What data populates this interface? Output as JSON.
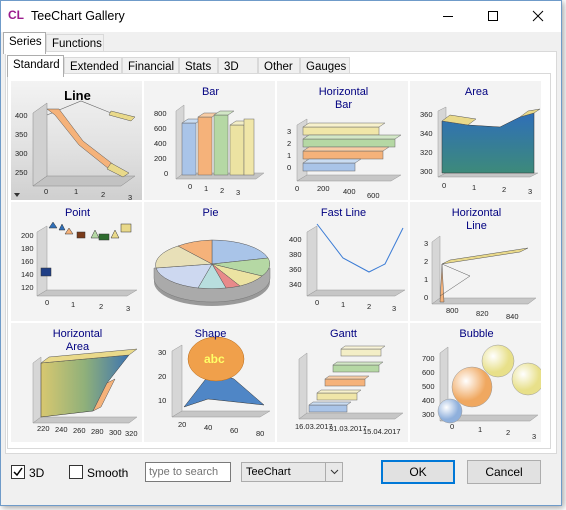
{
  "window": {
    "app_icon": "CL",
    "title": "TeeChart Gallery"
  },
  "outer_tabs": [
    "Series",
    "Functions"
  ],
  "inner_tabs": [
    "Standard",
    "Extended",
    "Financial",
    "Stats",
    "3D",
    "Other",
    "Gauges"
  ],
  "gallery": [
    {
      "title": "Line",
      "selected": true,
      "y_ticks": [
        "400",
        "350",
        "300",
        "250"
      ],
      "x_ticks": [
        "0",
        "1",
        "2",
        "3"
      ]
    },
    {
      "title": "Bar",
      "y_ticks": [
        "800",
        "600",
        "400",
        "200",
        "0"
      ],
      "x_ticks": [
        "0",
        "1",
        "2",
        "3"
      ]
    },
    {
      "title": "Horizontal\nBar",
      "y_ticks": [
        "3",
        "2",
        "1",
        "0"
      ],
      "x_ticks": [
        "0",
        "200",
        "400",
        "600"
      ]
    },
    {
      "title": "Area",
      "y_ticks": [
        "360",
        "340",
        "320",
        "300"
      ],
      "x_ticks": [
        "0",
        "1",
        "2",
        "3"
      ]
    },
    {
      "title": "Point",
      "y_ticks": [
        "200",
        "180",
        "160",
        "140",
        "120"
      ],
      "x_ticks": [
        "0",
        "1",
        "2",
        "3"
      ]
    },
    {
      "title": "Pie"
    },
    {
      "title": "Fast Line",
      "y_ticks": [
        "400",
        "380",
        "360",
        "340"
      ],
      "x_ticks": [
        "0",
        "1",
        "2",
        "3"
      ]
    },
    {
      "title": "Horizontal\nLine",
      "y_ticks": [
        "3",
        "2",
        "1",
        "0"
      ],
      "x_ticks": [
        "800",
        "820",
        "840"
      ]
    },
    {
      "title": "Horizontal\nArea",
      "x_ticks": [
        "220",
        "240",
        "260",
        "280",
        "300",
        "320"
      ]
    },
    {
      "title": "Shape",
      "shape_text": "abc",
      "y_ticks": [
        "30",
        "20",
        "10"
      ],
      "x_ticks": [
        "20",
        "40",
        "60",
        "80"
      ]
    },
    {
      "title": "Gantt",
      "x_ticks": [
        "16.03.2017",
        "31.03.2017",
        "15.04.2017"
      ]
    },
    {
      "title": "Bubble",
      "y_ticks": [
        "700",
        "600",
        "500",
        "400",
        "300"
      ],
      "x_ticks": [
        "0",
        "1",
        "2",
        "3"
      ]
    }
  ],
  "bottom": {
    "check_3d": {
      "label": "3D",
      "checked": true
    },
    "check_smooth": {
      "label": "Smooth",
      "checked": false
    },
    "search_placeholder": "type to search",
    "combo_value": "TeeChart",
    "ok_label": "OK",
    "cancel_label": "Cancel"
  },
  "colors": {
    "title_color": "#000080",
    "ok_border": "#0078d7",
    "icon_color": "#9b1b8d"
  }
}
